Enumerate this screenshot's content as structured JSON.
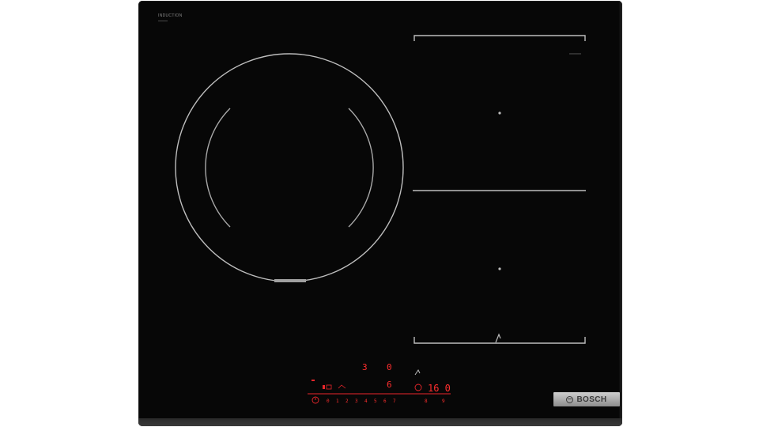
{
  "product": {
    "series_label": "INDUCTION",
    "brand": "BOSCH",
    "brand_logo_icon": "bosch-armature-icon"
  },
  "zones": {
    "round_zone_icon": "round-cooking-zone",
    "flex_zone_icon": "flex-induction-zone",
    "flex_zone_marker_icon": "zone-center-dot-icon",
    "flex_link_icon": "flexinduction-link-icon"
  },
  "control_panel": {
    "accent_color": "#ff2e2e",
    "zone_level_left": "3",
    "zone_level_right": "0",
    "zone_level_mid": "6",
    "timer_display": "16 0",
    "power_scale": [
      "0",
      "1",
      "2",
      "3",
      "4",
      "5",
      "6",
      "7",
      "8",
      "9"
    ],
    "power_icon": "power-on-off-icon",
    "timer_icon": "timer-clock-icon",
    "frying_sensor_icon": "frying-sensor-icon",
    "lock_icon": "childlock-icon"
  }
}
